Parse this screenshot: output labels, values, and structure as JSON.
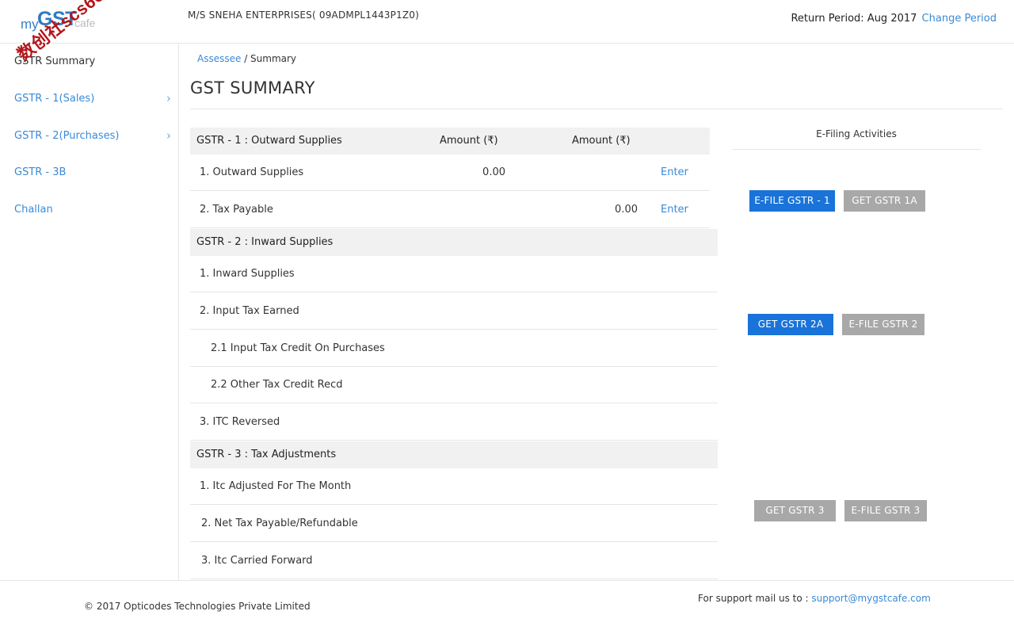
{
  "header": {
    "logo": {
      "my": "my",
      "gst": "GST",
      "cafe": "cafe"
    },
    "watermark": "数创社scs66",
    "company": "M/S SNEHA ENTERPRISES( 09ADMPL1443P1Z0)",
    "return_period_label": "Return Period: Aug 2017",
    "change_period": "Change Period"
  },
  "sidebar": {
    "items": [
      {
        "label": "GSTR Summary",
        "chevron": ""
      },
      {
        "label": "GSTR - 1(Sales)",
        "chevron": "›"
      },
      {
        "label": "GSTR - 2(Purchases)",
        "chevron": "›"
      },
      {
        "label": "GSTR - 3B",
        "chevron": ""
      },
      {
        "label": "Challan",
        "chevron": ""
      }
    ]
  },
  "breadcrumb": {
    "link": "Assessee",
    "separator": " / ",
    "current": "Summary"
  },
  "page_title": "GST SUMMARY",
  "table": {
    "gstr1": {
      "title": "GSTR - 1 : Outward Supplies",
      "col1": "Amount (₹)",
      "col2": "Amount (₹)",
      "rows": [
        {
          "label": "1. Outward Supplies",
          "value1": "0.00",
          "value2": "",
          "action": "Enter"
        },
        {
          "label": "2. Tax Payable",
          "value1": "",
          "value2": "0.00",
          "action": "Enter"
        }
      ]
    },
    "gstr2": {
      "title": "GSTR - 2 : Inward Supplies",
      "rows": [
        {
          "label": "1. Inward Supplies"
        },
        {
          "label": "2. Input Tax Earned"
        },
        {
          "label": "2.1 Input Tax Credit On Purchases"
        },
        {
          "label": "2.2 Other Tax Credit Recd"
        },
        {
          "label": "3. ITC Reversed"
        }
      ]
    },
    "gstr3": {
      "title": "GSTR - 3 : Tax Adjustments",
      "rows": [
        {
          "label": "1. Itc Adjusted For The Month"
        },
        {
          "label": "2. Net Tax Payable/Refundable"
        },
        {
          "label": "3. Itc Carried Forward"
        }
      ]
    }
  },
  "efiling": {
    "title": "E-Filing Activities",
    "buttons": {
      "efile_gstr1": "E-FILE GSTR - 1",
      "get_gstr1a": "GET GSTR 1A",
      "get_gstr2a": "GET GSTR 2A",
      "efile_gstr2": "E-FILE GSTR 2",
      "get_gstr3": "GET GSTR 3",
      "efile_gstr3": "E-FILE GSTR 3"
    }
  },
  "footer": {
    "copyright": "© 2017 Opticodes Technologies Private Limited",
    "support_label": "For support mail us to : ",
    "support_email": "support@mygstcafe.com"
  },
  "colors": {
    "primary_button": "#1a73d8",
    "disabled_button": "#a8a8a8",
    "link": "#3a8ad6",
    "section_bg": "#f1f1f1"
  }
}
